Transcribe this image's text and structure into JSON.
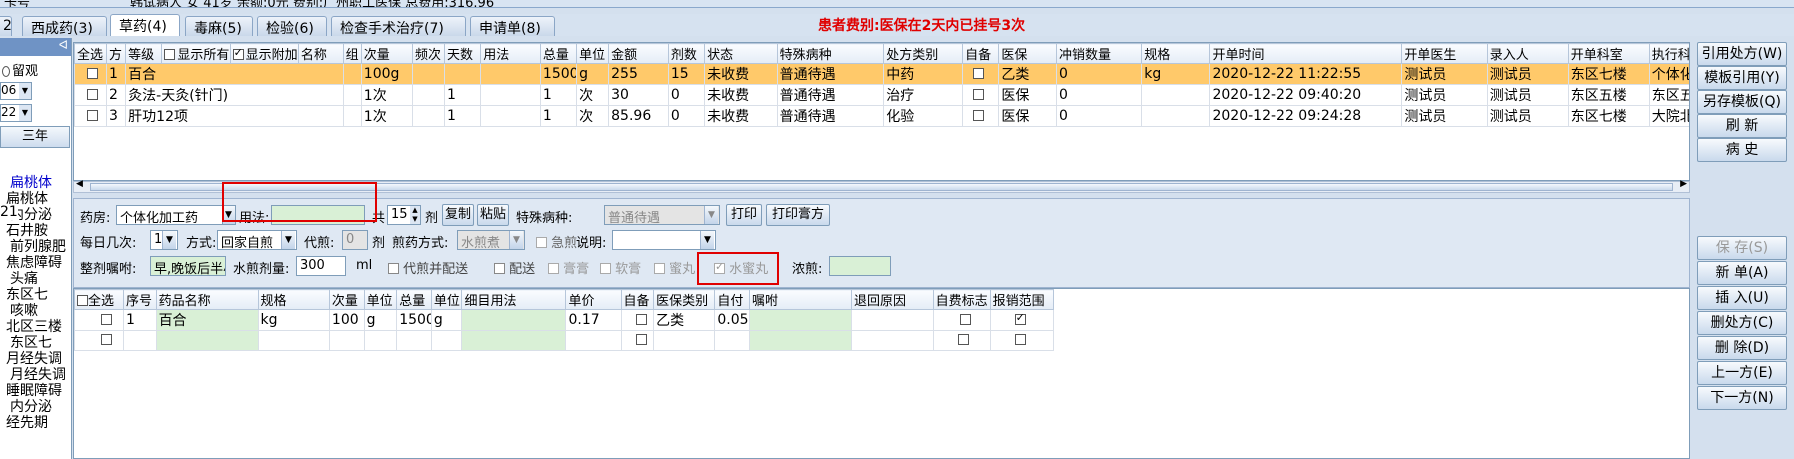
{
  "patient_info": {
    "label": "卡号",
    "text": "韩试病人 女 41岁 余额:0元 费别:广州职工医保 总费用:316.96"
  },
  "tabs": [
    {
      "label": "西成药(3)"
    },
    {
      "label": "草药(4)"
    },
    {
      "label": "毒麻(5)"
    },
    {
      "label": "检验(6)"
    },
    {
      "label": "检查手术治疗(7)"
    },
    {
      "label": "申请单(8)"
    }
  ],
  "warning": {
    "prefix": "患者费别:",
    "text": "医保在2天内已挂号3次"
  },
  "left_panel": {
    "radio_label": "留观",
    "date_month": "06",
    "date_day": "22",
    "button": "三年",
    "items": [
      "扁桃体",
      "扁桃体",
      "内分泌",
      "石井胺",
      "前列腺肥",
      "焦虑障碍",
      "头痛",
      "东区七",
      "咳嗽",
      "北区三楼",
      "东区七",
      "月经失调",
      "月经失调",
      "睡眠障碍",
      "内分泌",
      "经先期"
    ],
    "prefix": "21"
  },
  "grid1": {
    "headers": [
      "全选",
      "方",
      "等级",
      "显示所有",
      "显示附加",
      "名称",
      "组",
      "次量",
      "频次",
      "天数",
      "用法",
      "总量",
      "单位",
      "金额",
      "剂数",
      "状态",
      "特殊病种",
      "处方类别",
      "自备",
      "医保",
      "冲销数量",
      "规格",
      "开单时间",
      "开单医生",
      "录入人",
      "开单科室",
      "执行科室"
    ],
    "rows": [
      {
        "fang": "1",
        "name": "百合",
        "dose": "100g",
        "freq": "",
        "days": "",
        "usage": "",
        "total": "1500",
        "unit": "g",
        "amount": "255",
        "doses": "15",
        "status": "未收费",
        "special": "普通待遇",
        "rx_type": "中药",
        "ins": "乙类",
        "offset": "0",
        "spec": "kg",
        "time": "2020-12-22 11:22:55",
        "doctor": "测试员",
        "entry": "测试员",
        "dept": "东区七楼",
        "exec": "个体化加"
      },
      {
        "fang": "2",
        "name": "灸法-天灸(针门)",
        "dose": "1次",
        "freq": "",
        "days": "1",
        "usage": "",
        "total": "1",
        "unit": "次",
        "amount": "30",
        "doses": "0",
        "status": "未收费",
        "special": "普通待遇",
        "rx_type": "治疗",
        "ins": "医保",
        "offset": "0",
        "spec": "",
        "time": "2020-12-22 09:40:20",
        "doctor": "测试员",
        "entry": "测试员",
        "dept": "东区五楼",
        "exec": "东区五楼"
      },
      {
        "fang": "3",
        "name": "肝功12项",
        "dose": "1次",
        "freq": "",
        "days": "1",
        "usage": "",
        "total": "1",
        "unit": "次",
        "amount": "85.96",
        "doses": "0",
        "status": "未收费",
        "special": "普通待遇",
        "rx_type": "化验",
        "ins": "医保",
        "offset": "0",
        "spec": "",
        "time": "2020-12-22 09:24:28",
        "doctor": "测试员",
        "entry": "测试员",
        "dept": "东区七楼",
        "exec": "大院北区"
      }
    ]
  },
  "form": {
    "pharmacy_label": "药房:",
    "pharmacy_value": "个体化加工药",
    "usage_label": "用法:",
    "usage_value": "",
    "total_label": "共",
    "total_value": "15",
    "total_unit": "剂",
    "copy_btn": "复制",
    "paste_btn": "粘贴",
    "special_label": "特殊病种:",
    "special_value": "普通待遇",
    "print_btn": "打印",
    "print_ointment_btn": "打印膏方",
    "daily_label": "每日几次:",
    "daily_value": "1",
    "method_label": "方式:",
    "method_value": "回家自煎",
    "decoct_label": "代煎:",
    "decoct_value": "0",
    "decoct_unit": "剂",
    "decoct_method_label": "煎药方式:",
    "decoct_method_value": "水煎煮",
    "urgent_label": "急煎",
    "note_label": "说明:",
    "note_value": "",
    "instruction_label": "整剂嘱咐:",
    "instruction_value": "早,晚饭后半小",
    "water_label": "水煎剂量:",
    "water_value": "300",
    "water_unit": "ml",
    "cb_decoct_delivery": "代煎并配送",
    "cb_delivery": "配送",
    "cb_paste": "膏膏",
    "cb_soft_paste": "软膏",
    "cb_honey": "蜜丸",
    "cb_water_honey": "水蜜丸",
    "concentrate_label": "浓煎:",
    "concentrate_value": ""
  },
  "grid2": {
    "headers": [
      "全选",
      "序号",
      "药品名称",
      "规格",
      "次量",
      "单位",
      "总量",
      "单位",
      "细目用法",
      "单价",
      "自备",
      "医保类别",
      "自付",
      "嘱咐",
      "退回原因",
      "自费标志",
      "报销范围"
    ],
    "rows": [
      {
        "no": "1",
        "name": "百合",
        "spec": "kg",
        "dose": "100",
        "unit": "g",
        "total": "1500",
        "tunit": "g",
        "usage": "",
        "price": "0.17",
        "ins": "乙类",
        "self": "0.05",
        "note": "",
        "reason": ""
      }
    ]
  },
  "right_panel": {
    "buttons_top": [
      "引用处方(W)",
      "模板引用(Y)",
      "另存模板(Q)",
      "刷 新",
      "病 史"
    ],
    "buttons_bottom": [
      "保 存(S)",
      "新 单(A)",
      "插 入(U)",
      "删处方(C)",
      "删 除(D)",
      "上一方(E)",
      "下一方(N)"
    ]
  }
}
